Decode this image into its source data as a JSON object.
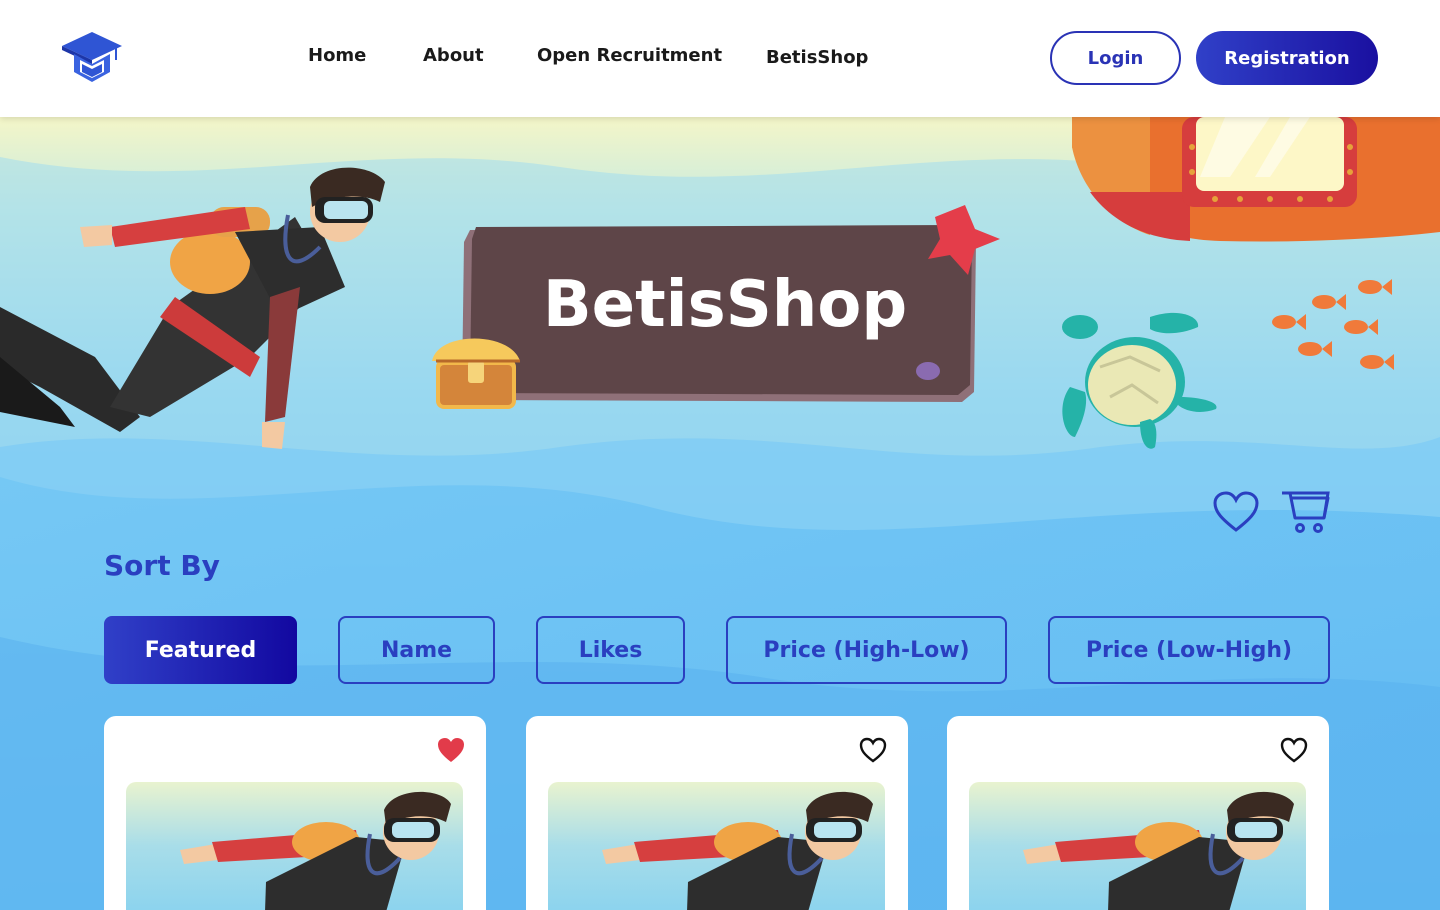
{
  "header": {
    "logo_icon": "graduation-cap-icon",
    "nav": [
      {
        "label": "Home"
      },
      {
        "label": "About"
      },
      {
        "label": "Open Recruitment"
      },
      {
        "label": "BetisShop"
      }
    ],
    "login_label": "Login",
    "registration_label": "Registration"
  },
  "hero": {
    "title": "BetisShop"
  },
  "actions": {
    "wishlist_icon": "heart-outline-icon",
    "cart_icon": "cart-icon"
  },
  "sort": {
    "label": "Sort By",
    "options": [
      {
        "label": "Featured",
        "active": true
      },
      {
        "label": "Name",
        "active": false
      },
      {
        "label": "Likes",
        "active": false
      },
      {
        "label": "Price (High-Low)",
        "active": false
      },
      {
        "label": "Price (Low-High)",
        "active": false
      }
    ]
  },
  "products": [
    {
      "liked": true
    },
    {
      "liked": false
    },
    {
      "liked": false
    }
  ],
  "colors": {
    "accent": "#2a3fc0",
    "liked": "#e23b4a",
    "sign": "#5e4548"
  }
}
